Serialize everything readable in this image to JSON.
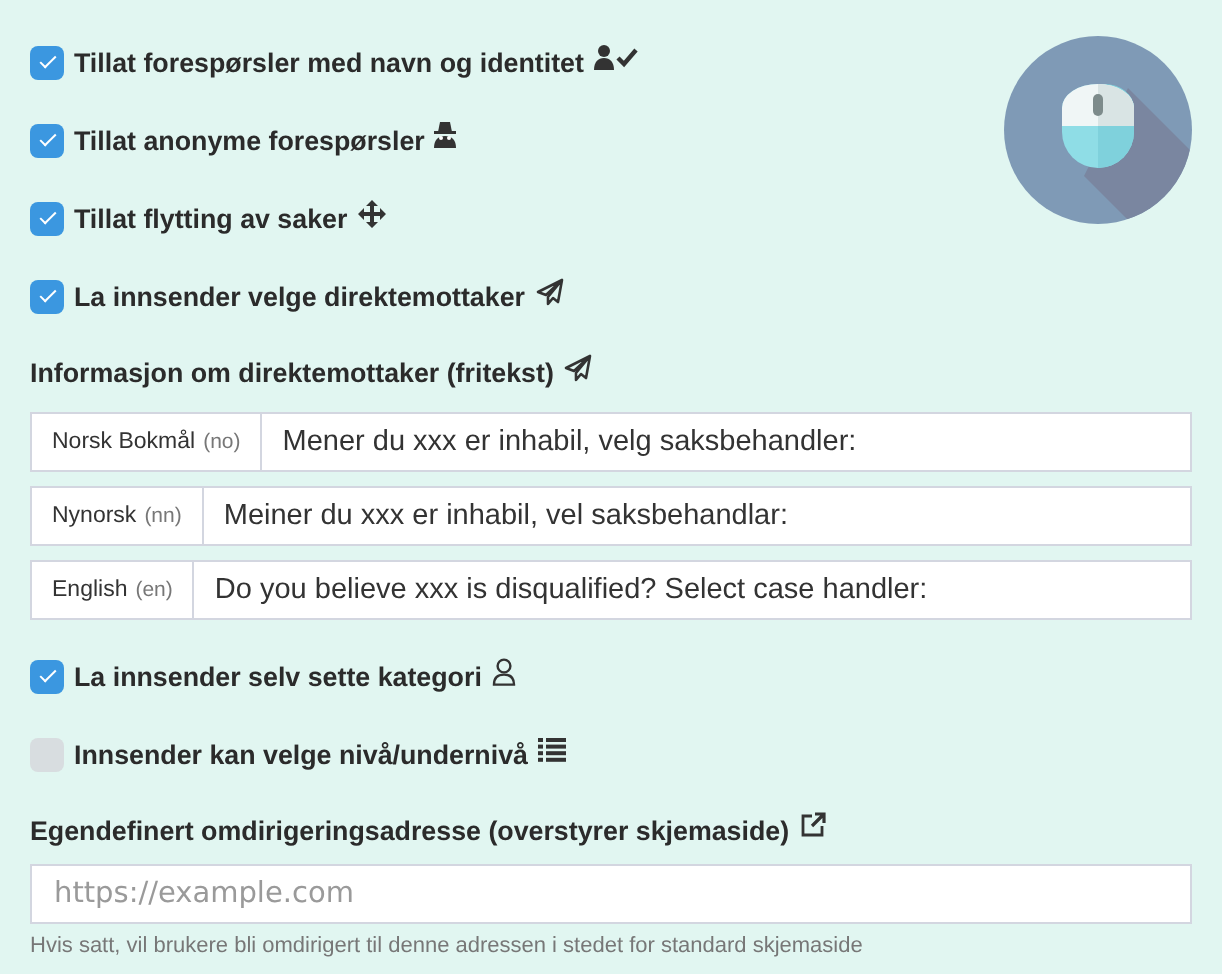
{
  "options_top": [
    {
      "label": "Tillat forespørsler med navn og identitet",
      "checked": true
    },
    {
      "label": "Tillat anonyme forespørsler",
      "checked": true
    },
    {
      "label": "Tillat flytting av saker",
      "checked": true
    },
    {
      "label": "La innsender velge direktemottaker",
      "checked": true
    }
  ],
  "recipient_info": {
    "heading": "Informasjon om direktemottaker (fritekst)",
    "translations": [
      {
        "language": "Norsk Bokmål",
        "code": "(no)",
        "value": "Mener du xxx er inhabil, velg saksbehandler:"
      },
      {
        "language": "Nynorsk",
        "code": "(nn)",
        "value": "Meiner du xxx er inhabil, vel saksbehandlar:"
      },
      {
        "language": "English",
        "code": "(en)",
        "value": "Do you believe xxx is disqualified? Select case handler:"
      }
    ]
  },
  "options_bottom": [
    {
      "label": "La innsender selv sette kategori",
      "checked": true
    },
    {
      "label": "Innsender kan velge nivå/undernivå",
      "checked": false
    }
  ],
  "redirect": {
    "label": "Egendefinert omdirigeringsadresse (overstyrer skjemaside)",
    "placeholder": "https://example.com",
    "help": "Hvis satt, vil brukere bli omdirigert til denne adressen i stedet for standard skjemaside"
  }
}
